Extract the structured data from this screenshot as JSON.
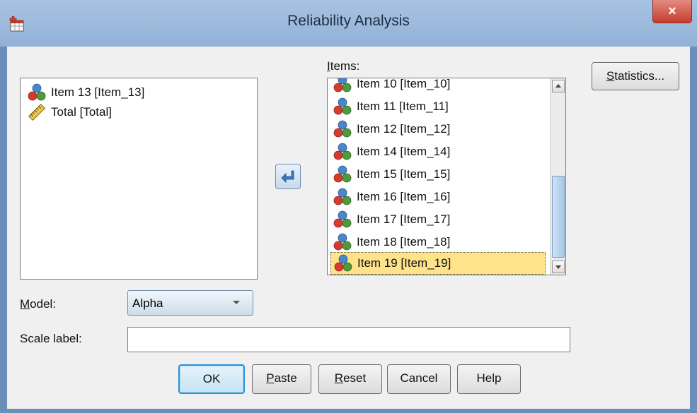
{
  "window": {
    "title": "Reliability Analysis",
    "close_glyph": "×"
  },
  "source_list": {
    "items": [
      {
        "label": "Item 13 [Item_13]",
        "icon": "nominal-variable-icon"
      },
      {
        "label": "Total [Total]",
        "icon": "scale-ruler-icon"
      }
    ]
  },
  "move_button": {
    "icon": "arrow-left-icon"
  },
  "items_list": {
    "label_prefix": "",
    "label_mnemonic": "I",
    "label_rest": "tems:",
    "items": [
      {
        "label": "Item 10 [Item_10]"
      },
      {
        "label": "Item 11 [Item_11]"
      },
      {
        "label": "Item 12 [Item_12]"
      },
      {
        "label": "Item 14 [Item_14]"
      },
      {
        "label": "Item 15 [Item_15]"
      },
      {
        "label": "Item 16 [Item_16]"
      },
      {
        "label": "Item 17 [Item_17]"
      },
      {
        "label": "Item 18 [Item_18]"
      },
      {
        "label": "Item 19 [Item_19]"
      }
    ],
    "selected_item": "Item 19 [Item_19]"
  },
  "statistics_button": {
    "mnemonic": "S",
    "rest": "tatistics..."
  },
  "model": {
    "mnemonic": "M",
    "rest": "odel:",
    "value": "Alpha"
  },
  "scale_label": {
    "label": "Scale label:",
    "value": ""
  },
  "buttons": {
    "ok": "OK",
    "paste_mnemonic": "P",
    "paste_rest": "aste",
    "reset_mnemonic": "R",
    "reset_rest": "eset",
    "cancel": "Cancel",
    "help": "Help"
  },
  "colors": {
    "selection": "#ffe38a",
    "accent": "#2f8fd4",
    "title_bar": "#9fbde0"
  }
}
